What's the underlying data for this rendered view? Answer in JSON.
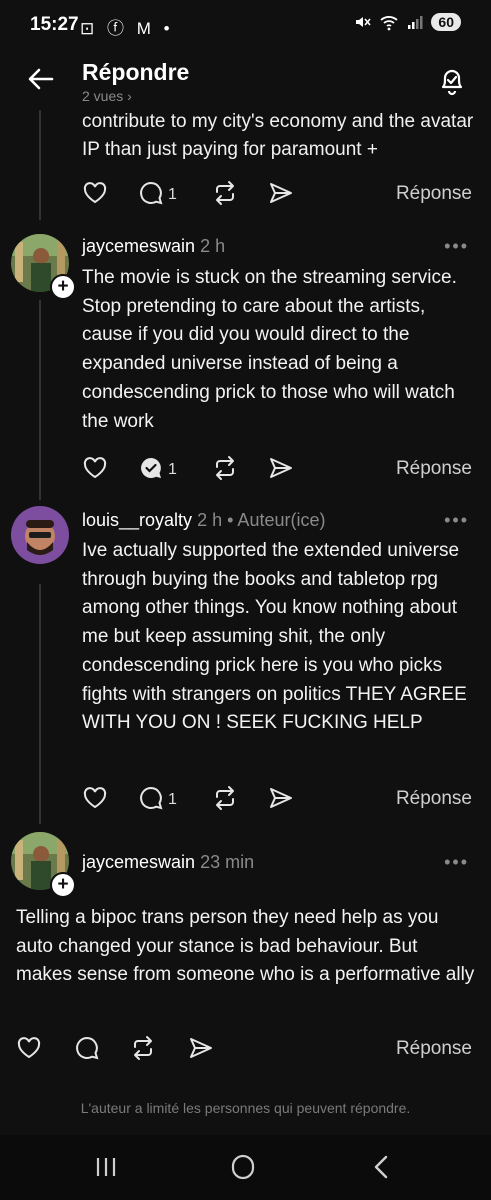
{
  "status_bar": {
    "time": "15:27",
    "left_icons": "⊡ ⓕ M •",
    "battery": "60"
  },
  "header": {
    "title": "Répondre",
    "views": "2 vues ›"
  },
  "cut_post": {
    "text": "contribute to my city's economy and the avatar IP than just paying for paramount +"
  },
  "cut_actions": {
    "reply_count": "1",
    "reply_label": "Réponse"
  },
  "posts": [
    {
      "username": "jaycemeswain",
      "time": "2 h",
      "role": "",
      "text": "The movie is stuck on the streaming service. Stop pretending to care about the artists, cause if you did you would direct to the expanded universe instead of being a condescending prick to those who will watch the work",
      "reply_count": "1",
      "reply_label": "Réponse"
    },
    {
      "username": "louis__royalty",
      "time": "2 h",
      "role": "• Auteur(ice)",
      "text": "Ive actually supported the extended universe through buying the books and tabletop rpg among other things. You know nothing about me but keep assuming shit, the only condescending prick here is you who picks fights with strangers on politics THEY AGREE WITH YOU ON ! SEEK FUCKING HELP",
      "reply_count": "1",
      "reply_label": "Réponse"
    },
    {
      "username": "jaycemeswain",
      "time": "23 min",
      "role": "",
      "text": "Telling a bipoc trans person they need help as you auto changed your stance is bad behaviour. But makes sense from someone who is a performative ally",
      "reply_count": "",
      "reply_label": "Réponse"
    }
  ],
  "footer": {
    "restricted_note": "L'auteur a limité les personnes qui peuvent répondre."
  },
  "colors": {
    "background": "#101010",
    "text": "#f3f3f3",
    "muted": "#8a8a8a",
    "thread_line": "#333333"
  }
}
